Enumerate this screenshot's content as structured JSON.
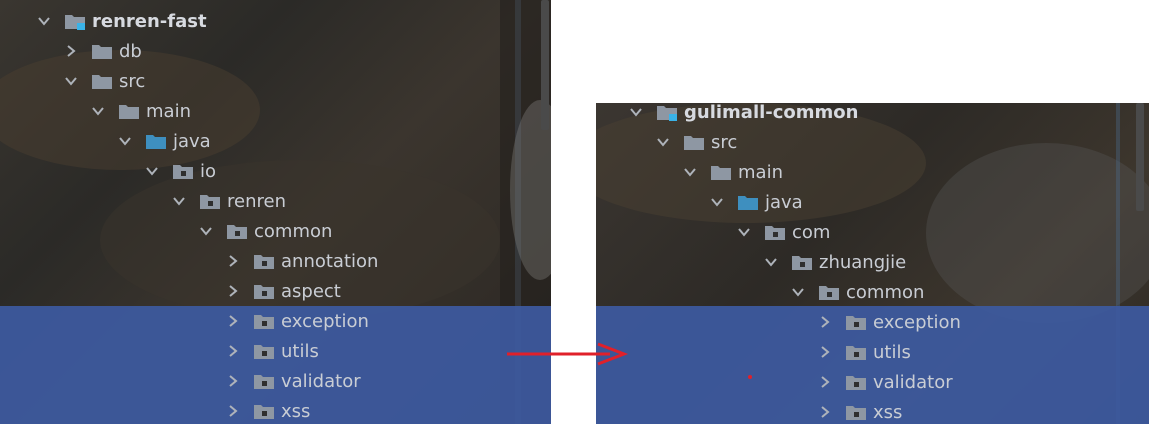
{
  "left_tree": {
    "rows": [
      {
        "label": "renren-fast",
        "depth": 0,
        "expanded": true,
        "bold": true,
        "icon": "module-folder-icon"
      },
      {
        "label": "db",
        "depth": 1,
        "expanded": false,
        "bold": false,
        "icon": "folder-icon"
      },
      {
        "label": "src",
        "depth": 1,
        "expanded": true,
        "bold": false,
        "icon": "folder-icon"
      },
      {
        "label": "main",
        "depth": 2,
        "expanded": true,
        "bold": false,
        "icon": "folder-icon"
      },
      {
        "label": "java",
        "depth": 3,
        "expanded": true,
        "bold": false,
        "icon": "source-folder-icon"
      },
      {
        "label": "io",
        "depth": 4,
        "expanded": true,
        "bold": false,
        "icon": "package-icon"
      },
      {
        "label": "renren",
        "depth": 5,
        "expanded": true,
        "bold": false,
        "icon": "package-icon"
      },
      {
        "label": "common",
        "depth": 6,
        "expanded": true,
        "bold": false,
        "icon": "package-icon"
      },
      {
        "label": "annotation",
        "depth": 7,
        "expanded": false,
        "bold": false,
        "icon": "package-icon"
      },
      {
        "label": "aspect",
        "depth": 7,
        "expanded": false,
        "bold": false,
        "icon": "package-icon"
      },
      {
        "label": "exception",
        "depth": 7,
        "expanded": false,
        "bold": false,
        "icon": "package-icon",
        "selected": true
      },
      {
        "label": "utils",
        "depth": 7,
        "expanded": false,
        "bold": false,
        "icon": "package-icon",
        "selected": true
      },
      {
        "label": "validator",
        "depth": 7,
        "expanded": false,
        "bold": false,
        "icon": "package-icon",
        "selected": true
      },
      {
        "label": "xss",
        "depth": 7,
        "expanded": false,
        "bold": false,
        "icon": "package-icon",
        "selected": true
      }
    ]
  },
  "right_tree": {
    "rows": [
      {
        "label": "gulimall-common",
        "depth": 0,
        "expanded": true,
        "bold": true,
        "icon": "module-folder-icon"
      },
      {
        "label": "src",
        "depth": 1,
        "expanded": true,
        "bold": false,
        "icon": "folder-icon"
      },
      {
        "label": "main",
        "depth": 2,
        "expanded": true,
        "bold": false,
        "icon": "folder-icon"
      },
      {
        "label": "java",
        "depth": 3,
        "expanded": true,
        "bold": false,
        "icon": "source-folder-icon"
      },
      {
        "label": "com",
        "depth": 4,
        "expanded": true,
        "bold": false,
        "icon": "package-icon"
      },
      {
        "label": "zhuangjie",
        "depth": 5,
        "expanded": true,
        "bold": false,
        "icon": "package-icon"
      },
      {
        "label": "common",
        "depth": 6,
        "expanded": true,
        "bold": false,
        "icon": "package-icon"
      },
      {
        "label": "exception",
        "depth": 7,
        "expanded": false,
        "bold": false,
        "icon": "package-icon",
        "selected": true
      },
      {
        "label": "utils",
        "depth": 7,
        "expanded": false,
        "bold": false,
        "icon": "package-icon",
        "selected": true
      },
      {
        "label": "validator",
        "depth": 7,
        "expanded": false,
        "bold": false,
        "icon": "package-icon",
        "selected": true
      },
      {
        "label": "xss",
        "depth": 7,
        "expanded": false,
        "bold": false,
        "icon": "package-icon",
        "selected": true
      }
    ]
  },
  "colors": {
    "selection": "#3d5aa1",
    "arrow": "#e0202a",
    "folder": "#8e97a3",
    "source_folder": "#3e8fbf",
    "module_badge": "#3ab3e8",
    "text": "#c9cdd4"
  }
}
